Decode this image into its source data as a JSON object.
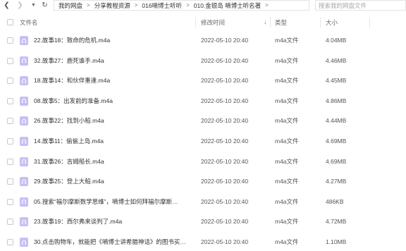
{
  "toolbar": {
    "back_icon": "chevron-left-icon",
    "forward_icon": "chevron-right-icon",
    "history_icon": "caret-down-icon",
    "refresh_icon": "refresh-icon"
  },
  "breadcrumb": [
    "我的网盘",
    "分享教程资源",
    "016嘀博士听听",
    "010.金银岛  嘀博士听名著"
  ],
  "search": {
    "placeholder": "搜索我的网盘文件"
  },
  "columns": {
    "name": "文件名",
    "modified": "修改时间",
    "type": "类型",
    "size": "大小"
  },
  "colors": {
    "accent": "#3a8ee6",
    "audio_icon": "#c7c0f4"
  },
  "files": [
    {
      "name": "22.故事18：致命的危机.m4a",
      "modified": "2022-05-10 20:40",
      "type": "m4a文件",
      "size": "4.04MB",
      "icon": "audio-file-icon"
    },
    {
      "name": "32.故事27：鹿死谁手.m4a",
      "modified": "2022-05-10 20:40",
      "type": "m4a文件",
      "size": "4.46MB",
      "icon": "audio-file-icon"
    },
    {
      "name": "18.故事14：和伙伴重逢.m4a",
      "modified": "2022-05-10 20:40",
      "type": "m4a文件",
      "size": "4.45MB",
      "icon": "audio-file-icon"
    },
    {
      "name": "08.故事5：出发前的准备.m4a",
      "modified": "2022-05-10 20:40",
      "type": "m4a文件",
      "size": "4.86MB",
      "icon": "audio-file-icon"
    },
    {
      "name": "26.故事22：找到小船.m4a",
      "modified": "2022-05-10 20:40",
      "type": "m4a文件",
      "size": "4.44MB",
      "icon": "audio-file-icon"
    },
    {
      "name": "14.故事11：偷偷上岛.m4a",
      "modified": "2022-05-10 20:40",
      "type": "m4a文件",
      "size": "4.69MB",
      "icon": "audio-file-icon"
    },
    {
      "name": "31.故事26：吉姆船长.m4a",
      "modified": "2022-05-10 20:40",
      "type": "m4a文件",
      "size": "4.69MB",
      "icon": "audio-file-icon"
    },
    {
      "name": "29.故事25：登上大船.m4a",
      "modified": "2022-05-10 20:40",
      "type": "m4a文件",
      "size": "4.27MB",
      "icon": "audio-file-icon"
    },
    {
      "name": "05.搜索“福尔摩斯数学思维”，嘀博士如何拜福尔摩斯…",
      "modified": "2022-05-10 20:40",
      "type": "m4a文件",
      "size": "486KB",
      "icon": "audio-file-icon"
    },
    {
      "name": "23.故事19：西尔弗来谈判了.m4a",
      "modified": "2022-05-10 20:40",
      "type": "m4a文件",
      "size": "4.72MB",
      "icon": "audio-file-icon"
    },
    {
      "name": "30.点击购物车，就能把《嘀博士讲希腊神话》的图书买…",
      "modified": "2022-05-10 20:40",
      "type": "m4a文件",
      "size": "1.10MB",
      "icon": "audio-file-icon"
    }
  ]
}
